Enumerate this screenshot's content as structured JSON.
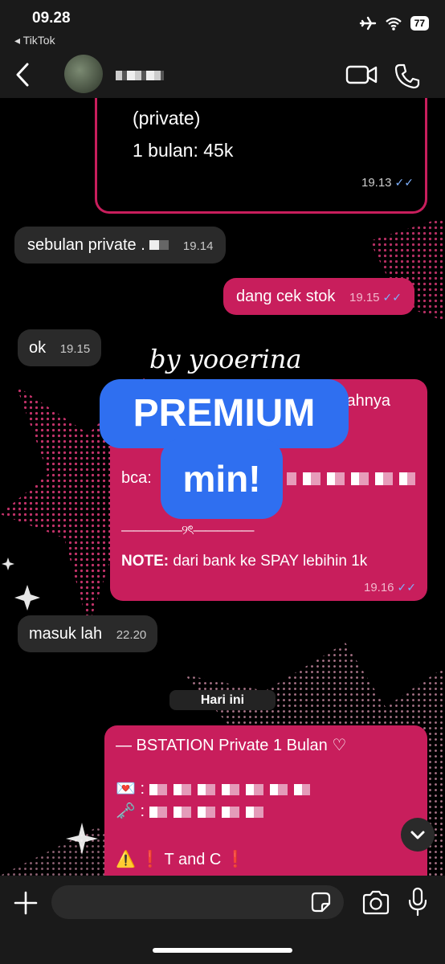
{
  "status_bar": {
    "time": "09.28",
    "back_app": "◂ TikTok",
    "battery": "77"
  },
  "header": {
    "contact_name": ""
  },
  "messages": [
    {
      "id": "m1",
      "direction": "out",
      "lines": [
        "(private)",
        "1 bulan: 45k"
      ],
      "time": "19.13",
      "read": true
    },
    {
      "id": "m2",
      "direction": "in",
      "text": "sebulan private .",
      "time": "19.14"
    },
    {
      "id": "m3",
      "direction": "out",
      "text": "dang cek stok",
      "time": "19.15",
      "read": true
    },
    {
      "id": "m4",
      "direction": "in",
      "text": "ok",
      "time": "19.15"
    },
    {
      "id": "m5",
      "direction": "out",
      "top_fragment": "lahnya",
      "bca_label": "bca:",
      "divider": "—————୨ৎ—————",
      "note_label": "NOTE:",
      "note_text": " dari bank ke SPAY lebihin 1k",
      "time": "19.16",
      "read": true
    },
    {
      "id": "m6",
      "direction": "in",
      "text": "masuk lah",
      "time": "22.20"
    },
    {
      "id": "m7",
      "direction": "out",
      "title": "— BSTATION Private 1 Bulan ♡",
      "line_email": "💌 :",
      "line_pass": "🗝️ :",
      "line_tc": "⚠️ ❗ T and C ❗"
    }
  ],
  "day_separator": "Hari ini",
  "overlay": {
    "signature": "by yooerina",
    "sticker_line1": "PREMIUM",
    "sticker_line2": "min!"
  },
  "colors": {
    "accent": "#c81e5c",
    "incoming": "#2a2a2a",
    "sticker": "#2f6ff0"
  }
}
